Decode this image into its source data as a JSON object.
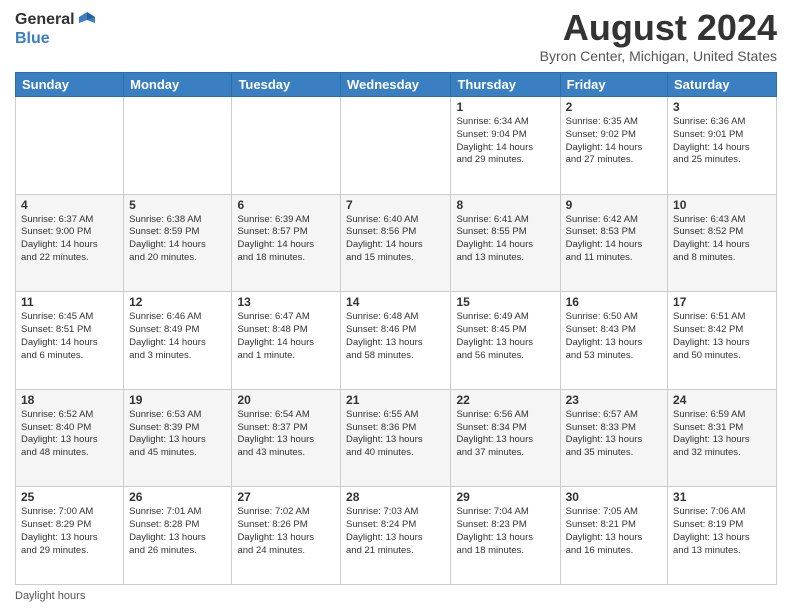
{
  "header": {
    "logo_general": "General",
    "logo_blue": "Blue",
    "month_title": "August 2024",
    "location": "Byron Center, Michigan, United States"
  },
  "days_of_week": [
    "Sunday",
    "Monday",
    "Tuesday",
    "Wednesday",
    "Thursday",
    "Friday",
    "Saturday"
  ],
  "footer": {
    "daylight_label": "Daylight hours"
  },
  "weeks": [
    [
      {
        "day": "",
        "info": ""
      },
      {
        "day": "",
        "info": ""
      },
      {
        "day": "",
        "info": ""
      },
      {
        "day": "",
        "info": ""
      },
      {
        "day": "1",
        "info": "Sunrise: 6:34 AM\nSunset: 9:04 PM\nDaylight: 14 hours\nand 29 minutes."
      },
      {
        "day": "2",
        "info": "Sunrise: 6:35 AM\nSunset: 9:02 PM\nDaylight: 14 hours\nand 27 minutes."
      },
      {
        "day": "3",
        "info": "Sunrise: 6:36 AM\nSunset: 9:01 PM\nDaylight: 14 hours\nand 25 minutes."
      }
    ],
    [
      {
        "day": "4",
        "info": "Sunrise: 6:37 AM\nSunset: 9:00 PM\nDaylight: 14 hours\nand 22 minutes."
      },
      {
        "day": "5",
        "info": "Sunrise: 6:38 AM\nSunset: 8:59 PM\nDaylight: 14 hours\nand 20 minutes."
      },
      {
        "day": "6",
        "info": "Sunrise: 6:39 AM\nSunset: 8:57 PM\nDaylight: 14 hours\nand 18 minutes."
      },
      {
        "day": "7",
        "info": "Sunrise: 6:40 AM\nSunset: 8:56 PM\nDaylight: 14 hours\nand 15 minutes."
      },
      {
        "day": "8",
        "info": "Sunrise: 6:41 AM\nSunset: 8:55 PM\nDaylight: 14 hours\nand 13 minutes."
      },
      {
        "day": "9",
        "info": "Sunrise: 6:42 AM\nSunset: 8:53 PM\nDaylight: 14 hours\nand 11 minutes."
      },
      {
        "day": "10",
        "info": "Sunrise: 6:43 AM\nSunset: 8:52 PM\nDaylight: 14 hours\nand 8 minutes."
      }
    ],
    [
      {
        "day": "11",
        "info": "Sunrise: 6:45 AM\nSunset: 8:51 PM\nDaylight: 14 hours\nand 6 minutes."
      },
      {
        "day": "12",
        "info": "Sunrise: 6:46 AM\nSunset: 8:49 PM\nDaylight: 14 hours\nand 3 minutes."
      },
      {
        "day": "13",
        "info": "Sunrise: 6:47 AM\nSunset: 8:48 PM\nDaylight: 14 hours\nand 1 minute."
      },
      {
        "day": "14",
        "info": "Sunrise: 6:48 AM\nSunset: 8:46 PM\nDaylight: 13 hours\nand 58 minutes."
      },
      {
        "day": "15",
        "info": "Sunrise: 6:49 AM\nSunset: 8:45 PM\nDaylight: 13 hours\nand 56 minutes."
      },
      {
        "day": "16",
        "info": "Sunrise: 6:50 AM\nSunset: 8:43 PM\nDaylight: 13 hours\nand 53 minutes."
      },
      {
        "day": "17",
        "info": "Sunrise: 6:51 AM\nSunset: 8:42 PM\nDaylight: 13 hours\nand 50 minutes."
      }
    ],
    [
      {
        "day": "18",
        "info": "Sunrise: 6:52 AM\nSunset: 8:40 PM\nDaylight: 13 hours\nand 48 minutes."
      },
      {
        "day": "19",
        "info": "Sunrise: 6:53 AM\nSunset: 8:39 PM\nDaylight: 13 hours\nand 45 minutes."
      },
      {
        "day": "20",
        "info": "Sunrise: 6:54 AM\nSunset: 8:37 PM\nDaylight: 13 hours\nand 43 minutes."
      },
      {
        "day": "21",
        "info": "Sunrise: 6:55 AM\nSunset: 8:36 PM\nDaylight: 13 hours\nand 40 minutes."
      },
      {
        "day": "22",
        "info": "Sunrise: 6:56 AM\nSunset: 8:34 PM\nDaylight: 13 hours\nand 37 minutes."
      },
      {
        "day": "23",
        "info": "Sunrise: 6:57 AM\nSunset: 8:33 PM\nDaylight: 13 hours\nand 35 minutes."
      },
      {
        "day": "24",
        "info": "Sunrise: 6:59 AM\nSunset: 8:31 PM\nDaylight: 13 hours\nand 32 minutes."
      }
    ],
    [
      {
        "day": "25",
        "info": "Sunrise: 7:00 AM\nSunset: 8:29 PM\nDaylight: 13 hours\nand 29 minutes."
      },
      {
        "day": "26",
        "info": "Sunrise: 7:01 AM\nSunset: 8:28 PM\nDaylight: 13 hours\nand 26 minutes."
      },
      {
        "day": "27",
        "info": "Sunrise: 7:02 AM\nSunset: 8:26 PM\nDaylight: 13 hours\nand 24 minutes."
      },
      {
        "day": "28",
        "info": "Sunrise: 7:03 AM\nSunset: 8:24 PM\nDaylight: 13 hours\nand 21 minutes."
      },
      {
        "day": "29",
        "info": "Sunrise: 7:04 AM\nSunset: 8:23 PM\nDaylight: 13 hours\nand 18 minutes."
      },
      {
        "day": "30",
        "info": "Sunrise: 7:05 AM\nSunset: 8:21 PM\nDaylight: 13 hours\nand 16 minutes."
      },
      {
        "day": "31",
        "info": "Sunrise: 7:06 AM\nSunset: 8:19 PM\nDaylight: 13 hours\nand 13 minutes."
      }
    ]
  ]
}
